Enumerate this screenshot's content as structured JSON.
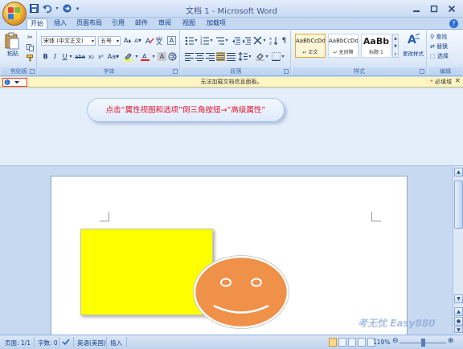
{
  "window": {
    "title": "文档 1 - Microsoft Word"
  },
  "qat": {
    "save": "save-icon",
    "undo": "undo-icon",
    "redo": "redo-icon",
    "customize": "▾"
  },
  "tabs": [
    "开始",
    "插入",
    "页面布局",
    "引用",
    "邮件",
    "审阅",
    "视图",
    "加载项"
  ],
  "ribbon": {
    "clipboard": {
      "label": "剪贴板",
      "paste": "粘贴"
    },
    "font": {
      "label": "字体",
      "name": "宋体 (中文正文)",
      "size": "五号"
    },
    "paragraph": {
      "label": "段落"
    },
    "styles": {
      "label": "样式",
      "items": [
        {
          "sample": "AaBbCcDd",
          "name": "↵ 正文"
        },
        {
          "sample": "AaBbCcDd",
          "name": "↵ 无间隔"
        },
        {
          "sample": "AaBb",
          "name": "标题 1"
        }
      ],
      "change": "更改样式"
    },
    "editing": {
      "label": "编辑",
      "find": "查找",
      "replace": "替换",
      "select": "选择"
    }
  },
  "infobar": {
    "title": "无法加载文档信息面板。",
    "required": "必填域"
  },
  "callout": {
    "text": "点击“属性视图和选项”倒三角按钮→“高级属性”"
  },
  "status": {
    "page": "页面: 1/1",
    "words": "字数: 0",
    "language": "英语(美国)",
    "mode": "插入",
    "zoom": "119%"
  },
  "watermark": "考无忧 Easy880",
  "colors": {
    "rect_fill": "#ffff00",
    "smiley_fill": "#f0914a",
    "callout_text": "#e0142a"
  }
}
